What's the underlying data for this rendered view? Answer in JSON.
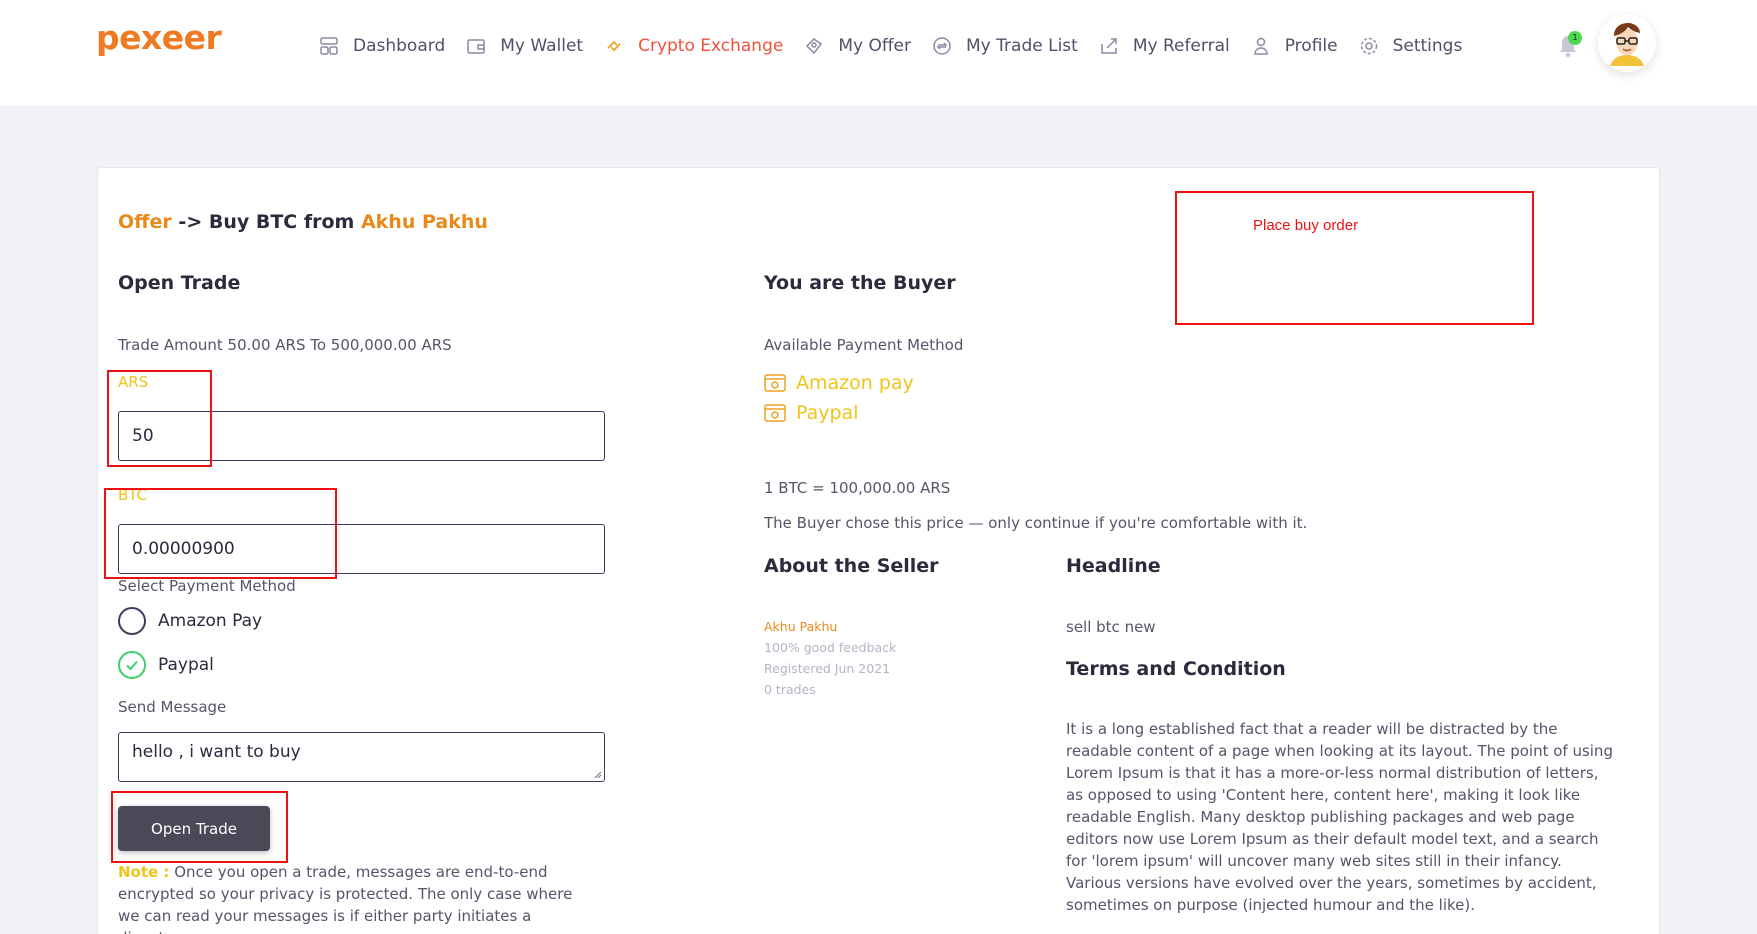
{
  "header": {
    "logo": "pexeer",
    "nav": [
      {
        "label": "Dashboard",
        "icon": "dashboard-icon"
      },
      {
        "label": "My Wallet",
        "icon": "wallet-icon"
      },
      {
        "label": "Crypto Exchange",
        "icon": "exchange-icon",
        "active": true
      },
      {
        "label": "My Offer",
        "icon": "offer-icon"
      },
      {
        "label": "My Trade List",
        "icon": "trade-list-icon"
      },
      {
        "label": "My Referral",
        "icon": "referral-icon"
      },
      {
        "label": "Profile",
        "icon": "user-icon"
      },
      {
        "label": "Settings",
        "icon": "gear-icon"
      }
    ],
    "notification_count": "1"
  },
  "breadcrumb": {
    "offer": "Offer",
    "middle": " -> Buy BTC from ",
    "seller": "Akhu Pakhu"
  },
  "open_trade": {
    "title": "Open Trade",
    "trade_amount": "Trade Amount 50.00 ARS To 500,000.00 ARS",
    "ars_label": "ARS",
    "ars_value": "50",
    "btc_label": "BTC",
    "btc_value": "0.00000900",
    "payment_label": "Select Payment Method",
    "payment_options": [
      {
        "label": "Amazon Pay",
        "selected": false
      },
      {
        "label": "Paypal",
        "selected": true
      }
    ],
    "message_label": "Send Message",
    "message_value": "hello , i want to buy",
    "button": "Open Trade",
    "note_label": "Note :",
    "note_text": " Once you open a trade, messages are end-to-end encrypted so your privacy is protected. The only case where we can read your messages is if either party initiates a dispute."
  },
  "buyer": {
    "title": "You are the Buyer",
    "available_label": "Available Payment Method",
    "methods": [
      "Amazon pay",
      "Paypal"
    ],
    "rate": "1 BTC = 100,000.00 ARS",
    "price_note": "The Buyer chose this price — only continue if you're comfortable with it."
  },
  "seller": {
    "title": "About the Seller",
    "name": "Akhu Pakhu",
    "feedback": "100% good feedback",
    "registered": "Registered Jun 2021",
    "trades": "0 trades"
  },
  "headline": {
    "title": "Headline",
    "text": "sell btc new"
  },
  "terms": {
    "title": "Terms and Condition",
    "text": "It is a long established fact that a reader will be distracted by the readable content of a page when looking at its layout. The point of using Lorem Ipsum is that it has a more-or-less normal distribution of letters, as opposed to using 'Content here, content here', making it look like readable English. Many desktop publishing packages and web page editors now use Lorem Ipsum as their default model text, and a search for 'lorem ipsum' will uncover many web sites still in their infancy. Various versions have evolved over the years, sometimes by accident, sometimes on purpose (injected humour and the like)."
  },
  "annotation": {
    "text": "Place buy order",
    "color": "#ee1111"
  },
  "colors": {
    "accent": "#f0513a",
    "brand": "#f07a24",
    "label_yellow": "#f0c419",
    "button": "#4a4958"
  }
}
